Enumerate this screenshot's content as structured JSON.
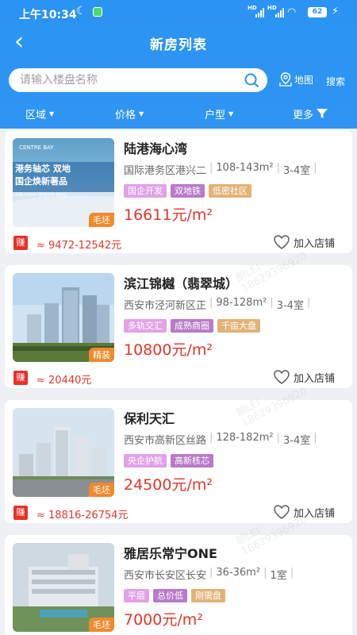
{
  "status_bar": {
    "time": "上午10:34",
    "battery": "62"
  },
  "nav": {
    "back_icon": "‹",
    "title": "新房列表"
  },
  "search": {
    "placeholder": "请输入楼盘名称",
    "map_label": "地图",
    "search_label": "搜索"
  },
  "filters": [
    {
      "label": "区域"
    },
    {
      "label": "价格"
    },
    {
      "label": "户型"
    },
    {
      "label": "更多"
    }
  ],
  "colors": {
    "primary": "#2b93f3",
    "price": "#e0362c",
    "tag_pink": "#e0a3e6",
    "tag_purple": "#b97bc9",
    "tag_tan": "#e2b376",
    "decoration": "#f08a2e"
  },
  "listings": [
    {
      "name": "陆港海心湾",
      "location": "国际港务区港兴二",
      "area": "108-143m²",
      "rooms": "3-4室",
      "tags": [
        "国企开发",
        "双地铁",
        "低密社区"
      ],
      "price": "16611元/m²",
      "decoration": "毛坯",
      "earn_badge": "赚",
      "commission": "≈ 9472-12542元",
      "add_label": "加入店铺",
      "image_text": {
        "brand": "CENTRE BAY",
        "line1": "港务轴芯 双地",
        "line2": "国企焕新著品",
        "line3": "108-143m² 宽境华宅 恭迎品"
      }
    },
    {
      "name": "滨江锦樾（翡翠城）",
      "location": "西安市泾河新区正",
      "area": "98-128m²",
      "rooms": "3-4室",
      "tags": [
        "多轨交汇",
        "成熟商圈",
        "千亩大盘"
      ],
      "price": "10800元/m²",
      "decoration": "精装",
      "earn_badge": "赚",
      "commission": "≈ 20440元",
      "add_label": "加入店铺"
    },
    {
      "name": "保利天汇",
      "location": "西安市高新区丝路",
      "area": "128-182m²",
      "rooms": "3-4室",
      "tags": [
        "央企护航",
        "高新核芯"
      ],
      "price": "24500元/m²",
      "decoration": "毛坯",
      "earn_badge": "赚",
      "commission": "≈ 18816-26754元",
      "add_label": "加入店铺"
    },
    {
      "name": "雅居乐常宁ONE",
      "location": "西安市长安区长安",
      "area": "36-36m²",
      "rooms": "1室",
      "tags": [
        "平层",
        "总价低",
        "刚需盘"
      ],
      "price": "7000元/m²",
      "decoration": "毛坯"
    }
  ],
  "watermark": {
    "line1": "朗LEI",
    "line2": "18629396920"
  }
}
